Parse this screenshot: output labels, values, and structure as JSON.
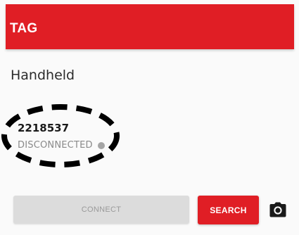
{
  "appbar": {
    "title": "TAG",
    "color": "#e01e25"
  },
  "section": {
    "title": "Handheld"
  },
  "device": {
    "id": "2218537",
    "status": "DISCONNECTED",
    "status_dot_color": "#a5a5a5"
  },
  "actions": {
    "connect_label": "CONNECT",
    "connect_enabled": false,
    "search_label": "SEARCH",
    "camera_icon": "camera-icon"
  }
}
